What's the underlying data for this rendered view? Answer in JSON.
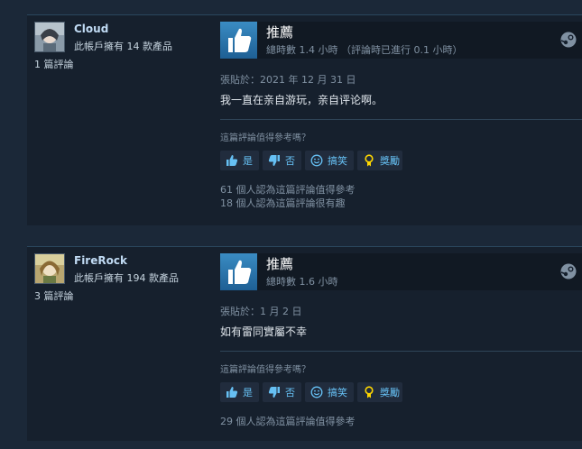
{
  "reviews": [
    {
      "username": "Cloud",
      "products": "此帳戶擁有 14 款產品",
      "review_count": "1 篇評論",
      "recommendation": "推薦",
      "hours": "總時數 1.4 小時 （評論時已進行 0.1 小時）",
      "posted": "張貼於：2021 年 12 月 31 日",
      "text": "我一直在亲自游玩，亲自评论啊。",
      "helpful_question": "這篇評論值得參考嗎？",
      "buttons": {
        "yes": "是",
        "no": "否",
        "funny": "搞笑",
        "award": "獎勵"
      },
      "stats": [
        "61 個人認為這篇評論值得參考",
        "18 個人認為這篇評論很有趣"
      ]
    },
    {
      "username": "FireRock",
      "products": "此帳戶擁有 194 款產品",
      "review_count": "3 篇評論",
      "recommendation": "推薦",
      "hours": "總時數 1.6 小時",
      "posted": "張貼於：1 月 2 日",
      "text": "如有雷同實屬不幸",
      "helpful_question": "這篇評論值得參考嗎？",
      "buttons": {
        "yes": "是",
        "no": "否",
        "funny": "搞笑",
        "award": "獎勵"
      },
      "stats": [
        "29 個人認為這篇評論值得參考"
      ]
    }
  ],
  "colors": {
    "background": "#1b2838",
    "card": "#16202d",
    "link": "#66c0f4",
    "username": "#c1dbf4",
    "muted": "#8091a2",
    "thumb_blue": "#2f7bb3"
  }
}
